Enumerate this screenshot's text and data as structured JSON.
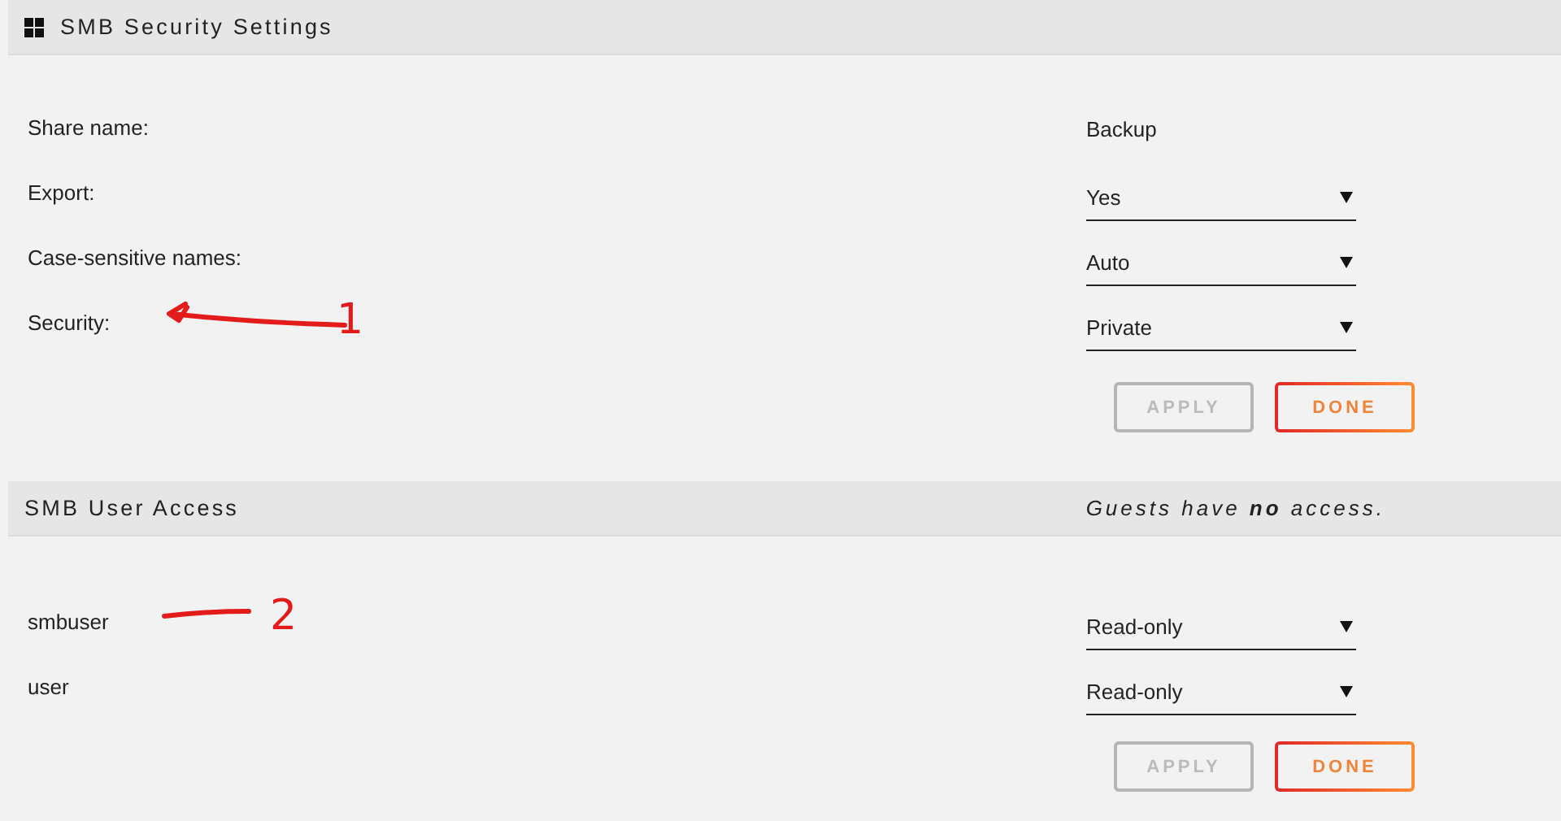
{
  "sections": [
    {
      "title": "SMB Security Settings",
      "rows": [
        {
          "label": "Share name:",
          "kind": "text",
          "value": "Backup"
        },
        {
          "label": "Export:",
          "kind": "select",
          "value": "Yes"
        },
        {
          "label": "Case-sensitive names:",
          "kind": "select",
          "value": "Auto"
        },
        {
          "label": "Security:",
          "kind": "select",
          "value": "Private"
        }
      ],
      "buttons": [
        {
          "label": "APPLY",
          "disabled": true
        },
        {
          "label": "DONE",
          "disabled": false
        }
      ]
    },
    {
      "title": "SMB User Access",
      "note": "Guests have **no** access.",
      "rows": [
        {
          "label": "smbuser",
          "kind": "select",
          "value": "Read-only"
        },
        {
          "label": "user",
          "kind": "select",
          "value": "Read-only"
        }
      ],
      "buttons": [
        {
          "label": "APPLY",
          "disabled": true
        },
        {
          "label": "DONE",
          "disabled": false
        }
      ]
    }
  ],
  "annotations": [
    {
      "kind": "arrow",
      "label": "1"
    },
    {
      "kind": "line",
      "label": "2"
    }
  ]
}
